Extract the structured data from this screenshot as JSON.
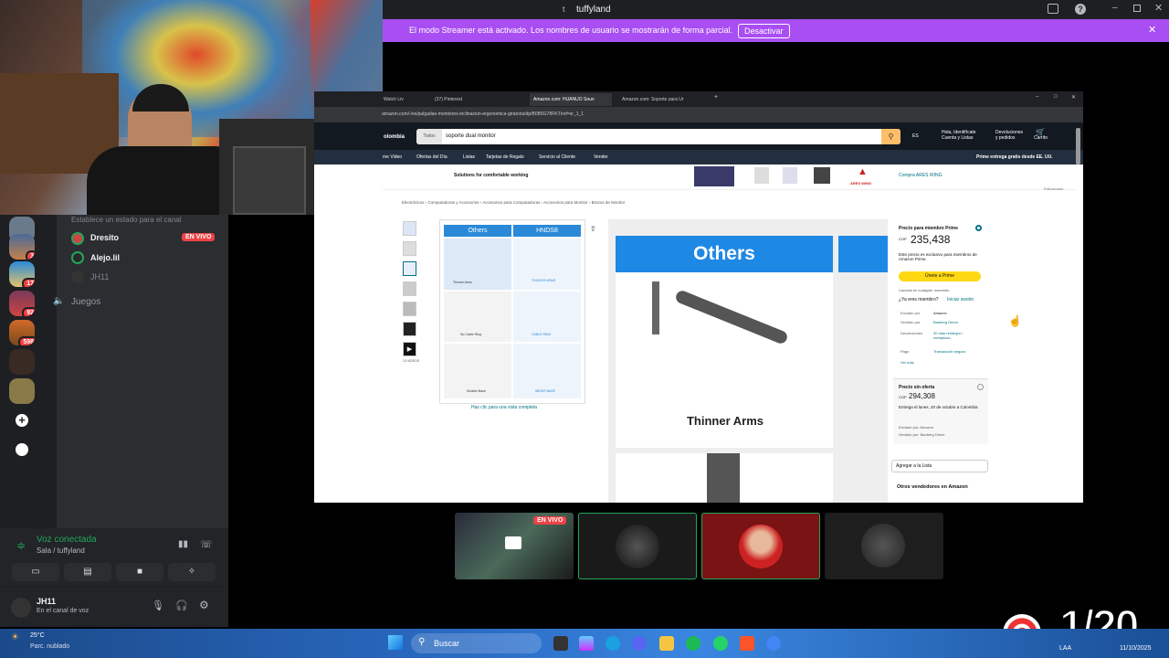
{
  "titlebar": {
    "title": "tuffyland"
  },
  "banner": {
    "message": "El modo Streamer está activado. Los nombres de usuario se mostrarán de forma parcial.",
    "button": "Desactivar"
  },
  "channels": {
    "status_placeholder": "Establece un estado para el canal",
    "users": [
      {
        "name": "Dresito",
        "badge": "EN VIVO"
      },
      {
        "name": "Alejo.lil"
      },
      {
        "name": "JH11"
      }
    ],
    "category": "Juegos"
  },
  "guild_badges": [
    "3",
    "17",
    "92",
    "598"
  ],
  "voice": {
    "status": "Voz conectada",
    "channel": "Sala / tuffyland"
  },
  "user": {
    "name": "JH11",
    "status": "En el canal de voz"
  },
  "browser": {
    "tabs": [
      "Watch Liv",
      "(37) Pinterest",
      "Amazon.com: HUANUO Soun",
      "Amazon.com: Soporte para Ur"
    ],
    "url": "amazon.com/-/es/pulgadas-monitores-inclinacion-ergonomica-giratoria/dp/B0B5G78FKT/ref=sr_1_1",
    "location": "olombia",
    "search_category": "Todos",
    "search_value": "soporte dual monitor",
    "lang": "ES",
    "account": "Hola, Identifícate\nCuenta y Listas",
    "returns": "Devoluciones\ny pedidos",
    "cart": "Carrito",
    "nav": [
      "me Video",
      "Ofertas del Día",
      "Listas",
      "Tarjetas de Regalo",
      "Servicio al Cliente",
      "Vender"
    ],
    "prime_note": "Prime entrega gratis desde EE. UU.",
    "ad_text": "Solutions for comfortable working",
    "ad_brand": "ARES WING",
    "ad_link": "Compra ARES WING",
    "sponsored": "Patrocinado",
    "breadcrumb": "Electrónicos › Computadoras y Accesorios › Accesorios para Computadoras › Accesorios para Monitor › Brazos de Monitor",
    "compare": {
      "left": "Others",
      "right": "HNDS8",
      "cells": [
        "Thinner Arms",
        "THICKER ARMS",
        "No Cable Ring",
        "CABLE RING",
        "Smaller Base",
        "WIDER BASE"
      ]
    },
    "view_full": "Haz clic para una vista completa",
    "main_image": {
      "heading": "Others",
      "caption": "Thinner Arms"
    },
    "thumb_count": "13 VIDEOS",
    "prime_price_label": "Precio para miembro Prime",
    "prime_price": "235,438",
    "prime_exclusive": "Este precio es exclusivo para miembros de Amazon Prime.",
    "join_prime": "Únete a Prime",
    "cancel_note": "Cancela en cualquier momento",
    "already_member": "¿Ya eres miembro?",
    "sign_in": "Iniciar sesión",
    "details": [
      [
        "Enviado por",
        "Amazon"
      ],
      [
        "Vendido por",
        "Baoberg Direct"
      ],
      [
        "Devoluciones",
        "30 días reintegro / reemplazo"
      ],
      [
        "Pago",
        "Transacción segura"
      ]
    ],
    "see_more": "Ver más",
    "no_offer_label": "Precio sin oferta",
    "no_offer_price": "294,308",
    "delivery": "Entrega el lunes, 20 de octubre a Colombia",
    "shipped_by": "Enviado por: Amazon",
    "sold_by": "Vendido por: Baoberg Direct",
    "add_list": "Agregar a la Lista",
    "other_sellers": "Otros vendedores en Amazon"
  },
  "stream": {
    "live": "EN VIVO"
  },
  "taskbar": {
    "weather_temp": "25°C",
    "weather_desc": "Parc. nublado",
    "search": "Buscar",
    "date": "11/10/2025",
    "lang": "LAA"
  },
  "overlay": {
    "counter": "1/20"
  },
  "colors": {
    "banner": "#a94ef2",
    "live": "#ed4245",
    "voice": "#23a55a",
    "prime_yellow": "#ffd814",
    "amazon_nav": "#232f3e"
  }
}
